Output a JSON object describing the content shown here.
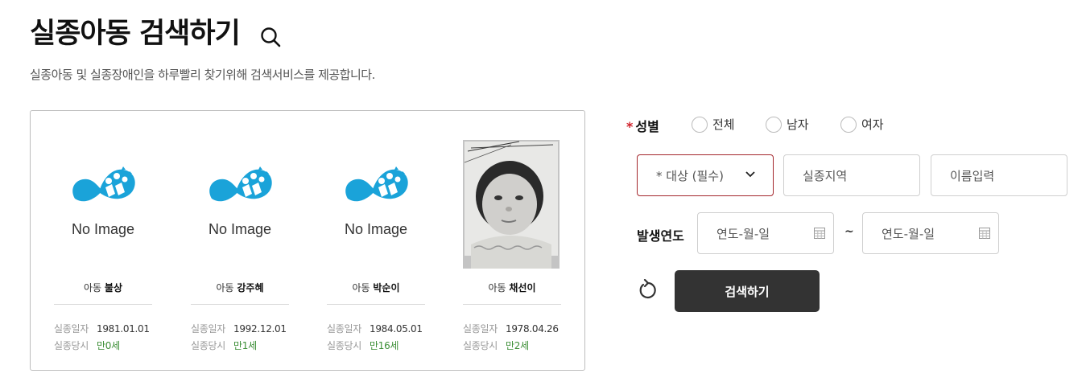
{
  "header": {
    "title": "실종아동 검색하기",
    "subtitle": "실종아동 및 실종장애인을 하루빨리 찾기위해 검색서비스를 제공합니다.",
    "search_icon": "search-icon"
  },
  "cards": [
    {
      "type_label": "아동",
      "name": "불상",
      "photo": "No Image",
      "date_label": "실종일자",
      "date": "1981.01.01",
      "age_label": "실종당시",
      "age": "만0세"
    },
    {
      "type_label": "아동",
      "name": "강주혜",
      "photo": "No Image",
      "date_label": "실종일자",
      "date": "1992.12.01",
      "age_label": "실종당시",
      "age": "만1세"
    },
    {
      "type_label": "아동",
      "name": "박순이",
      "photo": "No Image",
      "date_label": "실종일자",
      "date": "1984.05.01",
      "age_label": "실종당시",
      "age": "만16세"
    },
    {
      "type_label": "아동",
      "name": "채선이",
      "date_label": "실종일자",
      "date": "1978.04.26",
      "age_label": "실종당시",
      "age": "만2세"
    }
  ],
  "form": {
    "gender": {
      "required_mark": "*",
      "label": "성별",
      "options": [
        "전체",
        "남자",
        "여자"
      ]
    },
    "target_select": "* 대상 (필수)",
    "region_placeholder": "실종지역",
    "name_placeholder": "이름입력",
    "year": {
      "label": "발생연도",
      "from_placeholder": "연도-월-일",
      "separator": "~",
      "to_placeholder": "연도-월-일"
    },
    "reset_icon": "reset-icon",
    "search_button": "검색하기"
  },
  "colors": {
    "accent_required": "#d0202a",
    "age_green": "#3d8f37",
    "button_dark": "#333333",
    "logo_blue": "#1aa3d9"
  }
}
